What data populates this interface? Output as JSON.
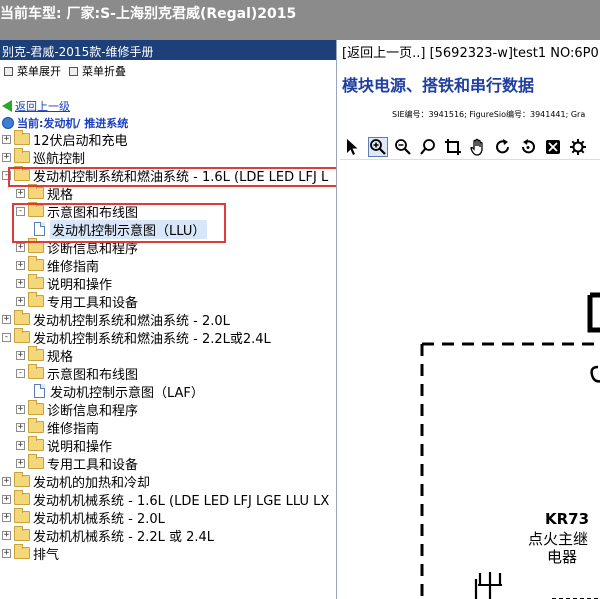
{
  "titlebar": {
    "text": "当前车型:  厂家:S-上海别克君威(Regal)2015"
  },
  "left": {
    "header": "别克-君威-2015款-维修手册",
    "menu": {
      "expand": "菜单展开",
      "collapse": "菜单折叠"
    },
    "back_link": "返回上一级",
    "current": "当前:发动机/ 推进系统",
    "tree": [
      {
        "label": "12伏启动和充电",
        "expander": "+",
        "icon": "folder"
      },
      {
        "label": "巡航控制",
        "expander": "+",
        "icon": "folder"
      },
      {
        "label": "发动机控制系统和燃油系统 - 1.6L (LDE LED LFJ L",
        "expander": "-",
        "icon": "folder"
      },
      {
        "label": "规格",
        "expander": "+",
        "icon": "folder"
      },
      {
        "label": "示意图和布线图",
        "expander": "-",
        "icon": "folder"
      },
      {
        "label": "发动机控制示意图（LLU）",
        "expander": "",
        "icon": "document"
      },
      {
        "label": "诊断信息和程序",
        "expander": "+",
        "icon": "folder"
      },
      {
        "label": "维修指南",
        "expander": "+",
        "icon": "folder"
      },
      {
        "label": "说明和操作",
        "expander": "+",
        "icon": "folder"
      },
      {
        "label": "专用工具和设备",
        "expander": "+",
        "icon": "folder"
      },
      {
        "label": "发动机控制系统和燃油系统 - 2.0L",
        "expander": "+",
        "icon": "folder"
      },
      {
        "label": "发动机控制系统和燃油系统 - 2.2L或2.4L",
        "expander": "-",
        "icon": "folder"
      },
      {
        "label": "规格",
        "expander": "+",
        "icon": "folder"
      },
      {
        "label": "示意图和布线图",
        "expander": "-",
        "icon": "folder"
      },
      {
        "label": "发动机控制示意图（LAF）",
        "expander": "",
        "icon": "document"
      },
      {
        "label": "诊断信息和程序",
        "expander": "+",
        "icon": "folder"
      },
      {
        "label": "维修指南",
        "expander": "+",
        "icon": "folder"
      },
      {
        "label": "说明和操作",
        "expander": "+",
        "icon": "folder"
      },
      {
        "label": "专用工具和设备",
        "expander": "+",
        "icon": "folder"
      },
      {
        "label": "发动机的加热和冷却",
        "expander": "+",
        "icon": "folder"
      },
      {
        "label": "发动机机械系统 - 1.6L (LDE LED LFJ LGE LLU LX",
        "expander": "+",
        "icon": "folder"
      },
      {
        "label": "发动机机械系统 - 2.0L",
        "expander": "+",
        "icon": "folder"
      },
      {
        "label": "发动机机械系统 - 2.2L 或 2.4L",
        "expander": "+",
        "icon": "folder"
      },
      {
        "label": "排气",
        "expander": "+",
        "icon": "folder"
      }
    ]
  },
  "right": {
    "nav_back": "[返回上一页..]",
    "nav_rest": "[5692323-w]test1 NO:6P0",
    "module_title": "模块电源、搭铁和串行数据",
    "sie_line": "SIE编号：3941516;  FigureSio编号：3941441;  Gra",
    "toolbar": [
      "pointer-icon",
      "zoom-in-icon",
      "zoom-out-icon",
      "zoom-icon",
      "crop-icon",
      "hand-icon",
      "redo-icon",
      "reset-icon",
      "fit-icon",
      "settings-icon"
    ],
    "diagram": {
      "relay_id": "KR73",
      "relay_name_1": "点火主继",
      "relay_name_2": "电器"
    }
  },
  "colors": {
    "titlebar_bg": "#8b8b8b",
    "left_header_bg": "#1d3f7a",
    "highlight_box": "#e03b3b",
    "module_title": "#1f3fa0"
  }
}
